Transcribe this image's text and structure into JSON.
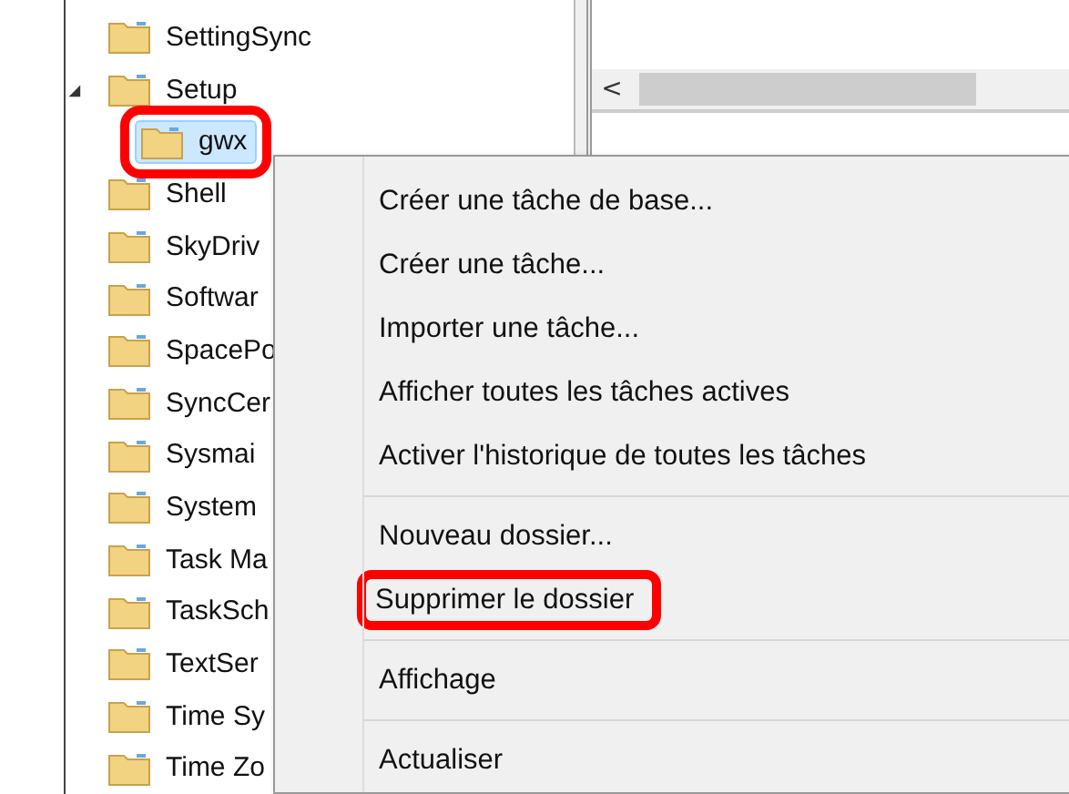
{
  "tree": {
    "items": [
      {
        "label": "SettingSync",
        "selected": false,
        "highlighted": false
      },
      {
        "label": "Setup",
        "selected": false,
        "highlighted": false,
        "expanded": true,
        "children": [
          {
            "label": "gwx",
            "selected": true,
            "highlighted": true
          }
        ]
      },
      {
        "label": "Shell",
        "selected": false,
        "highlighted": false
      },
      {
        "label": "SkyDriv",
        "selected": false,
        "highlighted": false
      },
      {
        "label": "Softwar",
        "selected": false,
        "highlighted": false
      },
      {
        "label": "SpacePo",
        "selected": false,
        "highlighted": false
      },
      {
        "label": "SyncCer",
        "selected": false,
        "highlighted": false
      },
      {
        "label": "Sysmai",
        "selected": false,
        "highlighted": false
      },
      {
        "label": "System",
        "selected": false,
        "highlighted": false
      },
      {
        "label": "Task Ma",
        "selected": false,
        "highlighted": false
      },
      {
        "label": "TaskSch",
        "selected": false,
        "highlighted": false
      },
      {
        "label": "TextSer",
        "selected": false,
        "highlighted": false
      },
      {
        "label": "Time Sy",
        "selected": false,
        "highlighted": false
      },
      {
        "label": "Time Zo",
        "selected": false,
        "highlighted": false
      }
    ]
  },
  "scrollbar": {
    "left_arrow": "<"
  },
  "context_menu": {
    "items": [
      {
        "kind": "item",
        "label": "Créer une tâche de base...",
        "highlighted": false
      },
      {
        "kind": "item",
        "label": "Créer une tâche...",
        "highlighted": false
      },
      {
        "kind": "item",
        "label": "Importer une tâche...",
        "highlighted": false
      },
      {
        "kind": "item",
        "label": "Afficher toutes les tâches actives",
        "highlighted": false
      },
      {
        "kind": "item",
        "label": "Activer l'historique de toutes les tâches",
        "highlighted": false
      },
      {
        "kind": "separator"
      },
      {
        "kind": "item",
        "label": "Nouveau dossier...",
        "highlighted": false
      },
      {
        "kind": "item",
        "label": "Supprimer le dossier",
        "highlighted": true
      },
      {
        "kind": "separator"
      },
      {
        "kind": "item",
        "label": "Affichage",
        "highlighted": false
      },
      {
        "kind": "separator"
      },
      {
        "kind": "item",
        "label": "Actualiser",
        "highlighted": false
      }
    ]
  }
}
